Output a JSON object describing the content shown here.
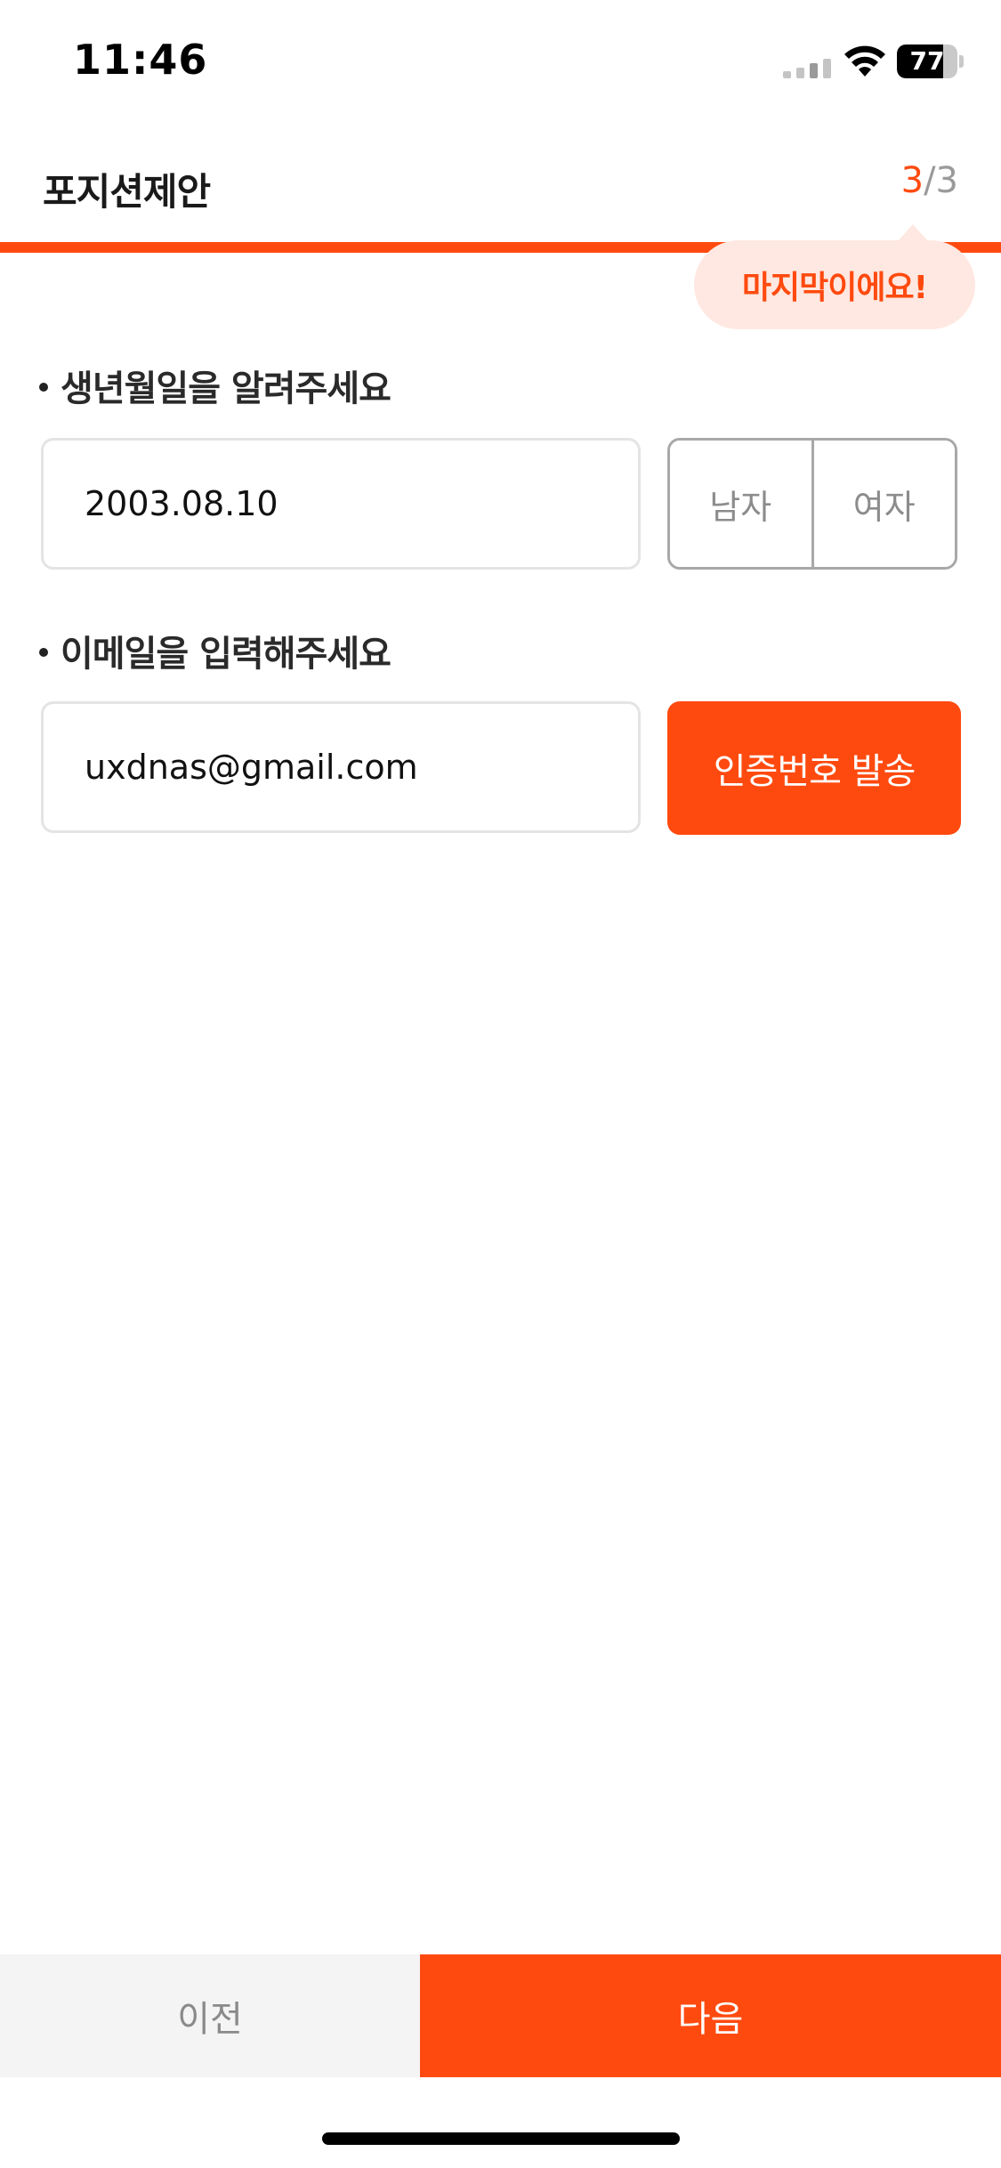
{
  "status_bar": {
    "time": "11:46",
    "battery_level": 77,
    "battery_text": "77",
    "icons": [
      "signal-icon",
      "wifi-icon",
      "battery-icon"
    ]
  },
  "header": {
    "title": "포지션제안",
    "step_current": "3",
    "step_separator": "/",
    "step_total": "3",
    "progress_fraction": 1.0
  },
  "tooltip": {
    "text": "마지막이에요!"
  },
  "birth": {
    "label": "생년월일을 알려주세요",
    "value": "2003.08.10",
    "gender_options": [
      "남자",
      "여자"
    ]
  },
  "email": {
    "label": "이메일을 입력해주세요",
    "value": "uxdnas@gmail.com",
    "send_button_label": "인증번호 발송"
  },
  "bottom_nav": {
    "prev_label": "이전",
    "next_label": "다음"
  },
  "colors": {
    "accent": "#ff4a0f",
    "tooltip_bg": "#ffe8e1",
    "prev_bg": "#f4f4f4"
  }
}
